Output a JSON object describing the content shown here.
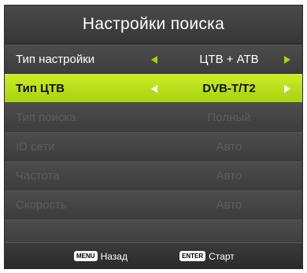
{
  "header": {
    "title": "Настройки поиска"
  },
  "rows": [
    {
      "label": "Тип настройки",
      "value": "ЦТВ + АТВ"
    },
    {
      "label": "Тип ЦТВ",
      "value": "DVB-T/T2"
    },
    {
      "label": "Тип поиска",
      "value": "Полный"
    },
    {
      "label": "ID сети",
      "value": "Авто"
    },
    {
      "label": "Частота",
      "value": "Авто"
    },
    {
      "label": "Скорость",
      "value": "Авто"
    }
  ],
  "footer": {
    "back_key": "MENU",
    "back_label": "Назад",
    "start_key": "ENTER",
    "start_label": "Старт"
  },
  "colors": {
    "selection": "#b5de18",
    "arrow": "#9fd318",
    "disabled_text": "#5c5c5c"
  }
}
